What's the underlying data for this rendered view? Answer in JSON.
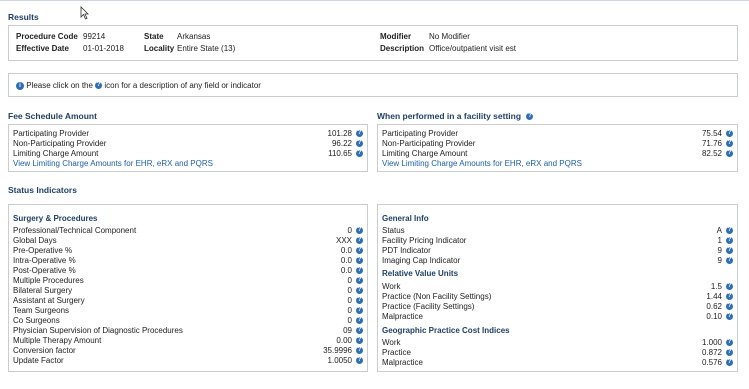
{
  "results": {
    "title": "Results",
    "procedure_code_label": "Procedure Code",
    "procedure_code": "99214",
    "effective_date_label": "Effective Date",
    "effective_date": "01-01-2018",
    "state_label": "State",
    "state": "Arkansas",
    "locality_label": "Locality",
    "locality": "Entire State (13)",
    "modifier_label": "Modifier",
    "modifier": "No Modifier",
    "description_label": "Description",
    "description": "Office/outpatient visit est"
  },
  "info": {
    "text_before": "Please click on the",
    "text_after": "icon for a description of any field or indicator"
  },
  "fee_schedule": {
    "title": "Fee Schedule Amount",
    "rows": [
      {
        "label": "Participating Provider",
        "value": "101.28"
      },
      {
        "label": "Non-Participating Provider",
        "value": "96.22"
      },
      {
        "label": "Limiting Charge Amount",
        "value": "110.65"
      }
    ],
    "link": "View Limiting Charge Amounts for EHR, eRX and PQRS"
  },
  "facility": {
    "title": "When performed in a facility setting",
    "rows": [
      {
        "label": "Participating Provider",
        "value": "75.54"
      },
      {
        "label": "Non-Participating Provider",
        "value": "71.76"
      },
      {
        "label": "Limiting Charge Amount",
        "value": "82.52"
      }
    ],
    "link": "View Limiting Charge Amounts for EHR, eRX and PQRS"
  },
  "status": {
    "title": "Status Indicators",
    "surgery_title": "Surgery & Procedures",
    "surgery_rows": [
      {
        "label": "Professional/Technical Component",
        "value": "0"
      },
      {
        "label": "Global Days",
        "value": "XXX"
      },
      {
        "label": "Pre-Operative %",
        "value": "0.0"
      },
      {
        "label": "Intra-Operative %",
        "value": "0.0"
      },
      {
        "label": "Post-Operative %",
        "value": "0.0"
      },
      {
        "label": "Multiple Procedures",
        "value": "0"
      },
      {
        "label": "Bilateral Surgery",
        "value": "0"
      },
      {
        "label": "Assistant at Surgery",
        "value": "0"
      },
      {
        "label": "Team Surgeons",
        "value": "0"
      },
      {
        "label": "Co Surgeons",
        "value": "0"
      },
      {
        "label": "Physician Supervision of Diagnostic Procedures",
        "value": "09"
      },
      {
        "label": "Multiple Therapy Amount",
        "value": "0.00"
      },
      {
        "label": "Conversion factor",
        "value": "35.9996"
      },
      {
        "label": "Update Factor",
        "value": "1.0050"
      }
    ],
    "general_title": "General Info",
    "general_rows": [
      {
        "label": "Status",
        "value": "A"
      },
      {
        "label": "Facility Pricing Indicator",
        "value": "1"
      },
      {
        "label": "PDT Indicator",
        "value": "9"
      },
      {
        "label": "Imaging Cap Indicator",
        "value": "9"
      }
    ],
    "rvu_title": "Relative Value Units",
    "rvu_rows": [
      {
        "label": "Work",
        "value": "1.5"
      },
      {
        "label": "Practice (Non Facility Settings)",
        "value": "1.44"
      },
      {
        "label": "Practice (Facility Settings)",
        "value": "0.62"
      },
      {
        "label": "Malpractice",
        "value": "0.10"
      }
    ],
    "gpci_title": "Geographic Practice Cost Indices",
    "gpci_rows": [
      {
        "label": "Work",
        "value": "1.000"
      },
      {
        "label": "Practice",
        "value": "0.872"
      },
      {
        "label": "Malpractice",
        "value": "0.576"
      }
    ]
  },
  "icons": {
    "help": "?",
    "info": "i"
  }
}
